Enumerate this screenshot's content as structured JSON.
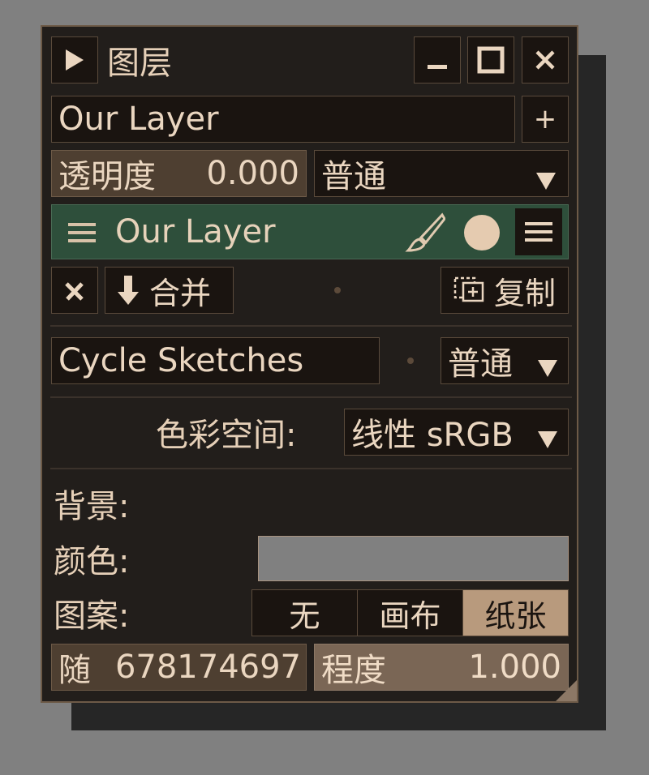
{
  "window": {
    "title": "图层"
  },
  "layer_name_input": {
    "value": "Our Layer"
  },
  "add_label": "+",
  "opacity": {
    "label": "透明度",
    "value": "0.000"
  },
  "blend_mode": {
    "value": "普通"
  },
  "layer_item": {
    "name": "Our Layer",
    "color": "#2e4f3b"
  },
  "merge_label": "合并",
  "copy_label": "复制",
  "cycle": {
    "name": "Cycle Sketches",
    "mode": "普通"
  },
  "colorspace": {
    "label": "色彩空间:",
    "value": "线性 sRGB"
  },
  "background": {
    "label": "背景:",
    "color_label": "颜色:",
    "color_value": "#808080",
    "pattern_label": "图案:",
    "pattern_options": [
      "无",
      "画布",
      "纸张"
    ],
    "selected_pattern": "纸张"
  },
  "seed": {
    "label": "随",
    "value": "678174697"
  },
  "strength": {
    "label": "程度",
    "value": "1.000"
  },
  "colors": {
    "accent": "#b89a7d",
    "panel_bg": "#221e1b",
    "layer_green": "#2e4f3b"
  }
}
